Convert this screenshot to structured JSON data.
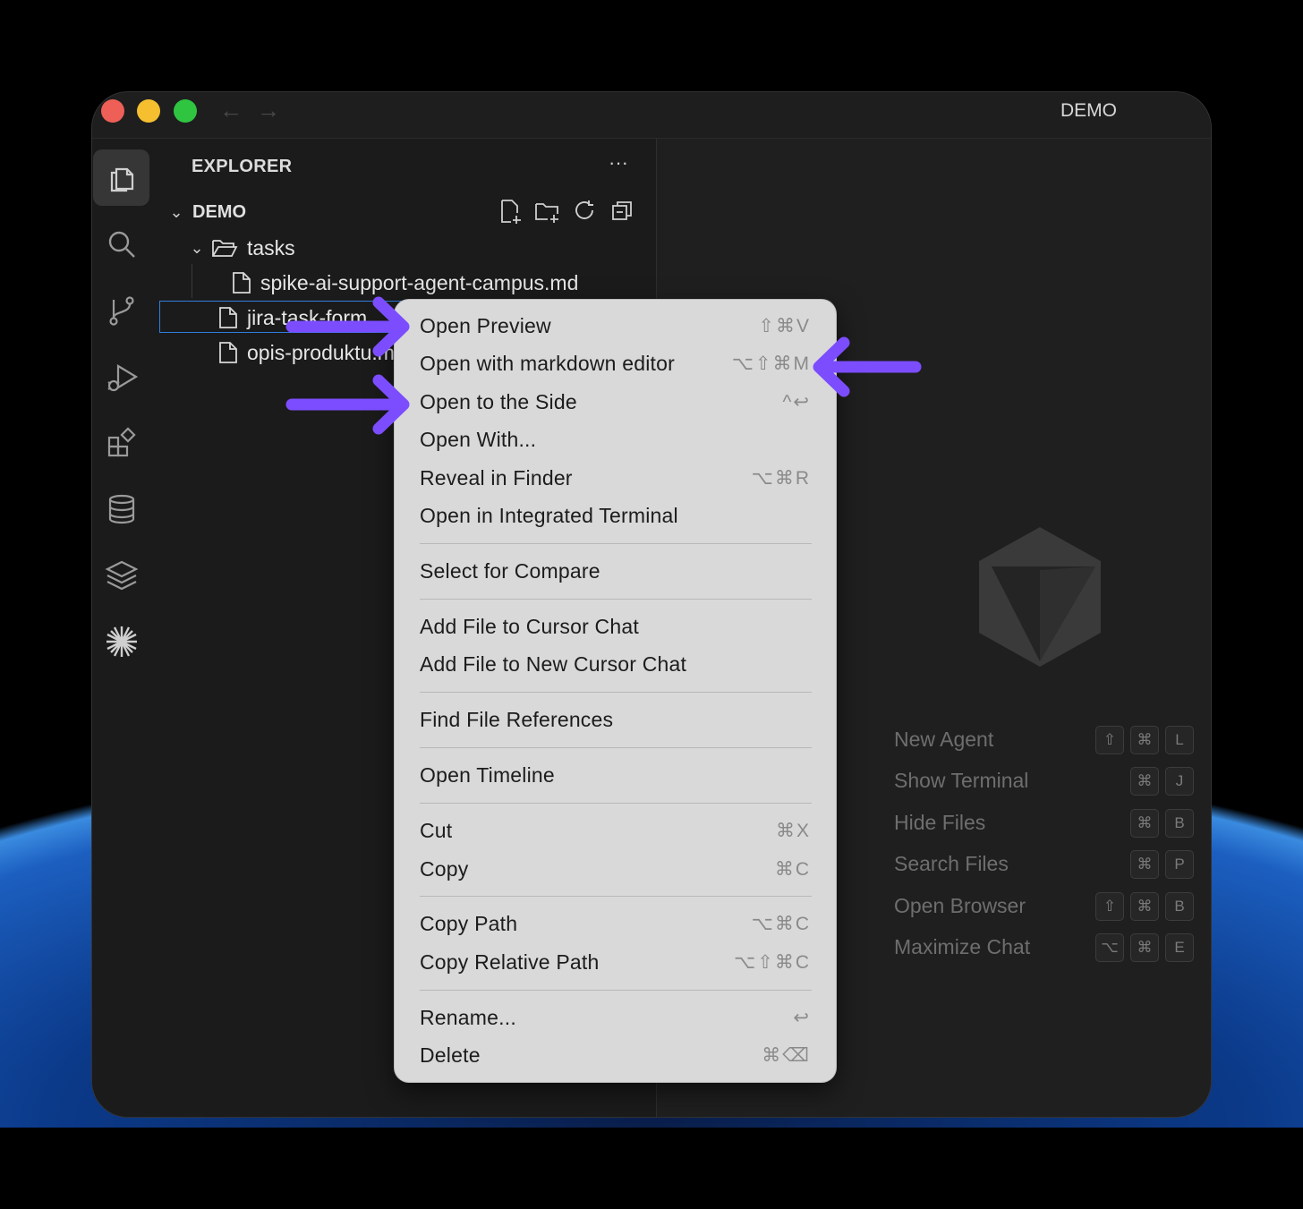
{
  "window": {
    "title": "DEMO"
  },
  "explorer": {
    "title": "EXPLORER",
    "more": "···",
    "section": "DEMO",
    "folder": "tasks",
    "files": [
      "spike-ai-support-agent-campus.md",
      "jira-task-form",
      "opis-produktu.m"
    ]
  },
  "context_menu": {
    "items": [
      {
        "label": "Open Preview",
        "shortcut": "⇧⌘V"
      },
      {
        "label": "Open with markdown editor",
        "shortcut": "⌥⇧⌘M"
      },
      {
        "label": "Open to the Side",
        "shortcut": "^↩"
      },
      {
        "label": "Open With...",
        "shortcut": ""
      },
      {
        "label": "Reveal in Finder",
        "shortcut": "⌥⌘R"
      },
      {
        "label": "Open in Integrated Terminal",
        "shortcut": ""
      },
      {
        "label": "Select for Compare",
        "shortcut": ""
      },
      {
        "label": "Add File to Cursor Chat",
        "shortcut": ""
      },
      {
        "label": "Add File to New Cursor Chat",
        "shortcut": ""
      },
      {
        "label": "Find File References",
        "shortcut": ""
      },
      {
        "label": "Open Timeline",
        "shortcut": ""
      },
      {
        "label": "Cut",
        "shortcut": "⌘X"
      },
      {
        "label": "Copy",
        "shortcut": "⌘C"
      },
      {
        "label": "Copy Path",
        "shortcut": "⌥⌘C"
      },
      {
        "label": "Copy Relative Path",
        "shortcut": "⌥⇧⌘C"
      },
      {
        "label": "Rename...",
        "shortcut": "↩"
      },
      {
        "label": "Delete",
        "shortcut": "⌘⌫"
      }
    ]
  },
  "shortcuts": [
    {
      "label": "New Agent",
      "keys": [
        "⇧",
        "⌘",
        "L"
      ]
    },
    {
      "label": "Show Terminal",
      "keys": [
        "⌘",
        "J"
      ]
    },
    {
      "label": "Hide Files",
      "keys": [
        "⌘",
        "B"
      ]
    },
    {
      "label": "Search Files",
      "keys": [
        "⌘",
        "P"
      ]
    },
    {
      "label": "Open Browser",
      "keys": [
        "⇧",
        "⌘",
        "B"
      ]
    },
    {
      "label": "Maximize Chat",
      "keys": [
        "⌥",
        "⌘",
        "E"
      ]
    }
  ],
  "colors": {
    "accent_arrow": "#7c4dff",
    "selection_border": "#2f7de0"
  }
}
